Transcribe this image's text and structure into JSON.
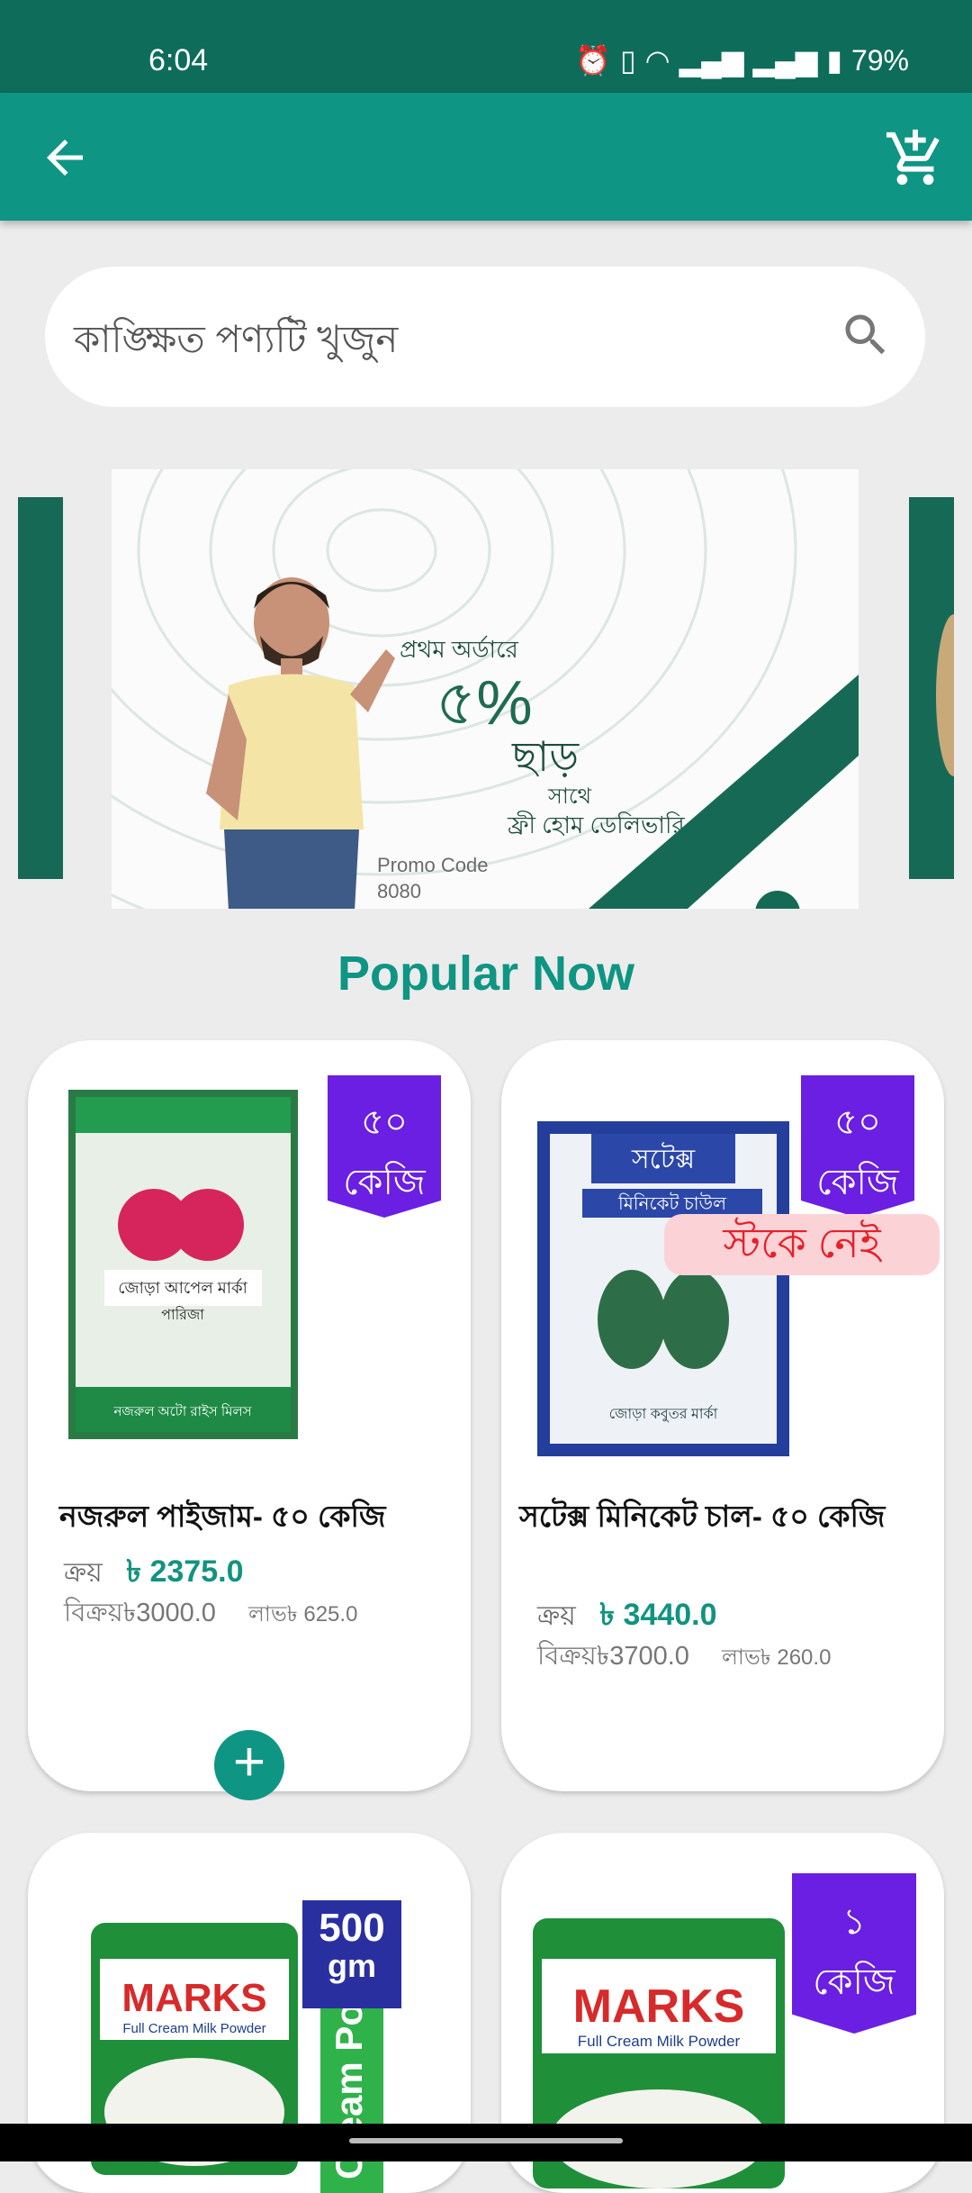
{
  "status": {
    "time": "6:04",
    "battery": "79%"
  },
  "search": {
    "placeholder": "কাঙ্ক্ষিত পণ্যটি খুজুন"
  },
  "banner": {
    "line1": "প্রথম অর্ডারে",
    "line2": "৫%",
    "line3": "ছাড়",
    "line4": "সাথে",
    "line5": "ফ্রী হোম ডেলিভারি",
    "promo_label": "Promo Code",
    "promo_code": "8080"
  },
  "section_title": "Popular Now",
  "products": [
    {
      "badge_qty": "৫০",
      "badge_unit": "কেজি",
      "name": "নজরুল পাইজাম- ৫০ কেজি",
      "buy_label": "ক্রয়",
      "buy_price": "৳ 2375.0",
      "sell_label": "বিক্রয়",
      "sell_price": "৳3000.0",
      "profit_label": "লাভ",
      "profit": "৳ 625.0",
      "bag_title": "নজরুল অটো রাইস মিলস",
      "bag_sub": "জোড়া আপেল মার্কা",
      "bag_type": "পারিজা"
    },
    {
      "badge_qty": "৫০",
      "badge_unit": "কেজি",
      "name": "সটেক্স মিনিকেট চাল- ৫০ কেজি",
      "buy_label": "ক্রয়",
      "buy_price": "৳ 3440.0",
      "sell_label": "বিক্রয়",
      "sell_price": "৳3700.0",
      "profit_label": "লাভ",
      "profit": "৳ 260.0",
      "stock_label": "স্টকে নেই",
      "bag_title": "সটেক্স",
      "bag_sub": "মিনিকেট চাউল",
      "bag_brand": "জোড়া কবুতর মার্কা"
    },
    {
      "badge_qty": "500",
      "badge_unit": "gm",
      "bag_brand": "MARKS",
      "bag_sub": "Full Cream Milk Powder",
      "side_text": "Cream Powder"
    },
    {
      "badge_qty": "১",
      "badge_unit": "কেজি",
      "bag_brand": "MARKS",
      "bag_sub": "Full Cream Milk Powder"
    }
  ],
  "colors": {
    "primary": "#0e9583",
    "status_bar": "#0e6d5a",
    "badge": "#6a1fe3",
    "oos_bg": "#fbd3d6",
    "oos_text": "#e8202a"
  }
}
